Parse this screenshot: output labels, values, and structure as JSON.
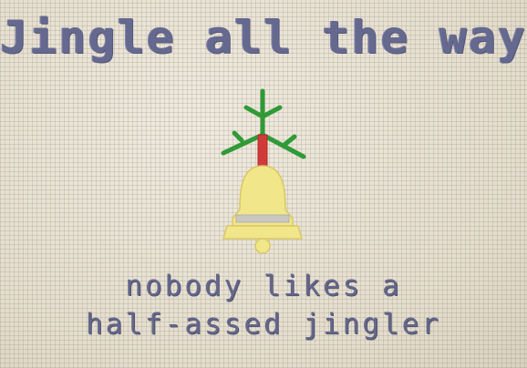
{
  "title": "Jingle all the way",
  "caption": {
    "line1": "nobody likes a",
    "line2": "half-assed jingler"
  },
  "colors": {
    "fabric": "#e9e3d6",
    "thread_text": "#6b6f9a",
    "bell": "#f2e68a",
    "bell_band": "#c9c7c2",
    "holly_green": "#2f9a37",
    "stem_red": "#d23a3a"
  },
  "icons": [
    "bell-icon",
    "holly-icon"
  ]
}
